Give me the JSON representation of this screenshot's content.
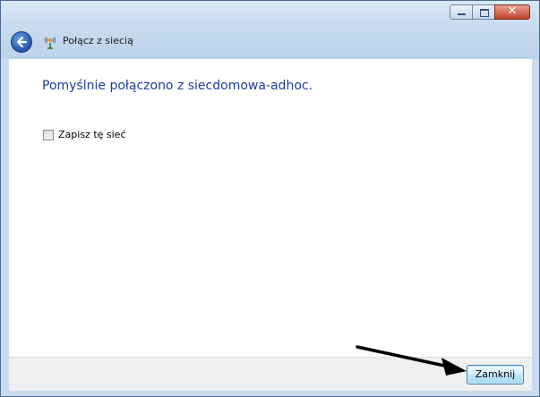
{
  "window": {
    "title": "Połącz z siecią",
    "caption_buttons": [
      "minimize",
      "maximize",
      "close"
    ]
  },
  "content": {
    "heading": "Pomyślnie połączono z siecdomowa-adhoc.",
    "save_network_checkbox": {
      "label": "Zapisz tę sieć",
      "checked": false
    }
  },
  "footer": {
    "close_label": "Zamknij"
  },
  "icons": {
    "back": "back-arrow-icon",
    "wizard": "network-connect-icon",
    "pointer": "annotation-arrow"
  },
  "colors": {
    "heading": "#1e3f9a",
    "frame": "#c9dbee",
    "footer": "#f0f0f0"
  }
}
